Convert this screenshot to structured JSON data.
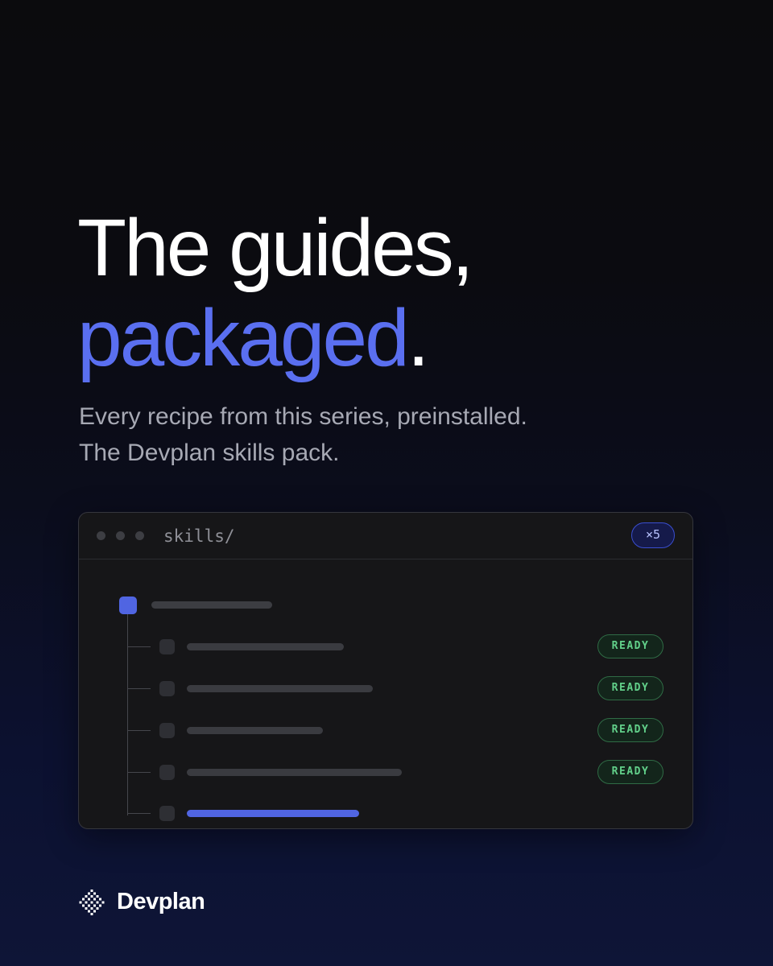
{
  "hero": {
    "line1": "The guides,",
    "accent_word": "packaged",
    "accent_suffix": ".",
    "subtitle_line1": "Every recipe from this series, preinstalled.",
    "subtitle_line2": "The Devplan skills pack."
  },
  "window": {
    "path": "skills/",
    "count_badge": "×5",
    "items": [
      {
        "status": "READY"
      },
      {
        "status": "READY"
      },
      {
        "status": "READY"
      },
      {
        "status": "READY"
      },
      {
        "status": "",
        "active": true
      }
    ]
  },
  "brand": {
    "name": "Devplan",
    "logo_icon": "checker-diamond-logo"
  },
  "colors": {
    "accent": "#5a6ff0",
    "ready_green": "#62d08a",
    "background_top": "#0b0b0d",
    "background_bottom": "#0e1537"
  }
}
